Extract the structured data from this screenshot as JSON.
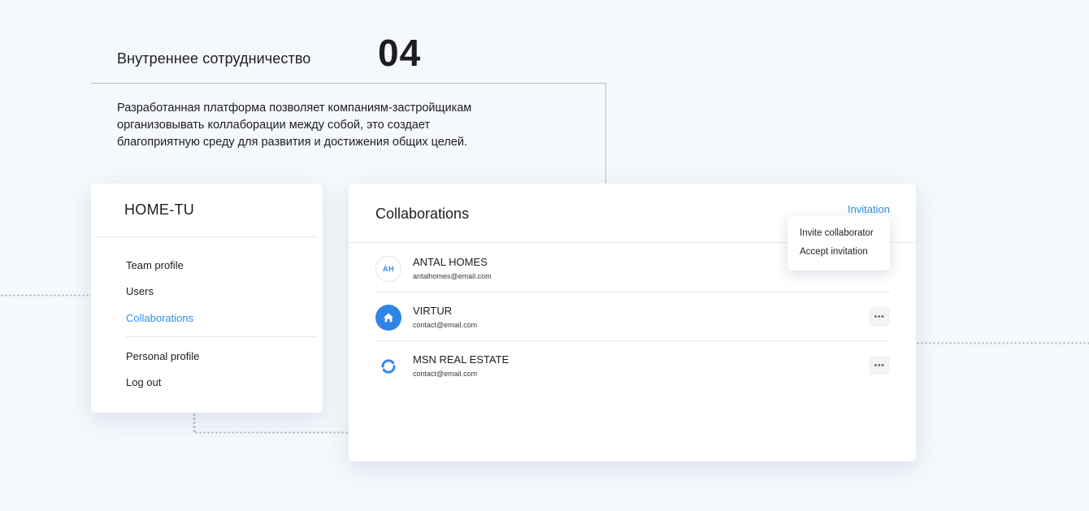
{
  "section": {
    "title": "Внутреннее сотрудничество",
    "number": "04",
    "description": "Разработанная платформа позволяет компаниям-застройщикам организовывать коллаборации между собой, это создает благоприятную среду для развития и достижения общих целей."
  },
  "sidebar": {
    "brand": "HOME-TU",
    "items": [
      {
        "label": "Team profile"
      },
      {
        "label": "Users"
      },
      {
        "label": "Collaborations",
        "active": true
      }
    ],
    "secondary_items": [
      {
        "label": "Personal profile"
      },
      {
        "label": "Log out"
      }
    ]
  },
  "main": {
    "title": "Collaborations",
    "invitation_label": "Invitation",
    "dropdown": {
      "items": [
        {
          "label": "Invite collaborator"
        },
        {
          "label": "Accept invitation"
        }
      ]
    },
    "collaborators": [
      {
        "name": "ANTAL HOMES",
        "email": "antalhomes@email.com",
        "logo_text": "AH",
        "icon": "initials-logo"
      },
      {
        "name": "VIRTUR",
        "email": "contact@email.com",
        "icon": "home-icon"
      },
      {
        "name": "MSN REAL ESTATE",
        "email": "contact@email.com",
        "icon": "sync-icon"
      }
    ],
    "more_label": "•••"
  },
  "colors": {
    "accent": "#2f8ee8",
    "background": "#f5f8fd",
    "text": "#1d1d1f"
  }
}
